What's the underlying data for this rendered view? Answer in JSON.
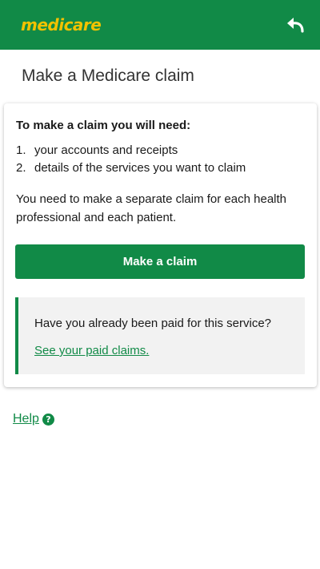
{
  "colors": {
    "brand_green": "#118a47",
    "logo_yellow": "#f2c200",
    "callout_bg": "#f2f2f2"
  },
  "header": {
    "logo_text": "medicare",
    "back_icon": "reply-arrow-icon"
  },
  "page": {
    "title": "Make a Medicare claim"
  },
  "card": {
    "heading": "To make a claim you will need:",
    "requirements": [
      {
        "num": "1.",
        "text": "your accounts and receipts"
      },
      {
        "num": "2.",
        "text": "details of the services you want to claim"
      }
    ],
    "note": "You need to make a separate claim for each health professional and each patient.",
    "button_label": "Make a claim",
    "callout": {
      "text": "Have you already been paid for this service?",
      "link": "See your paid claims."
    }
  },
  "help": {
    "label": "Help",
    "icon": "question-circle-icon",
    "icon_glyph": "?"
  }
}
